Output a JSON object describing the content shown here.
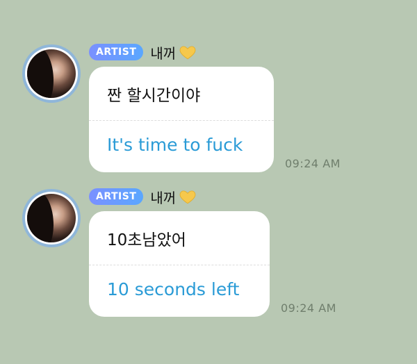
{
  "messages": [
    {
      "badge": "ARTIST",
      "sender": "내꺼",
      "heart_icon": "yellow-heart-icon",
      "text_ko": "짠 할시간이야",
      "text_en": "It's time to fuck",
      "time": "09:24 AM"
    },
    {
      "badge": "ARTIST",
      "sender": "내꺼",
      "heart_icon": "yellow-heart-icon",
      "text_ko": "10초남았어",
      "text_en": "10 seconds left",
      "time": "09:24 AM"
    }
  ],
  "colors": {
    "background": "#b8c8b3",
    "badge_gradient_start": "#7a90ff",
    "badge_gradient_end": "#5aa7ff",
    "translation_text": "#2a9bd6",
    "heart": "#f6c84c",
    "avatar_ring": "#8fb6d9"
  }
}
